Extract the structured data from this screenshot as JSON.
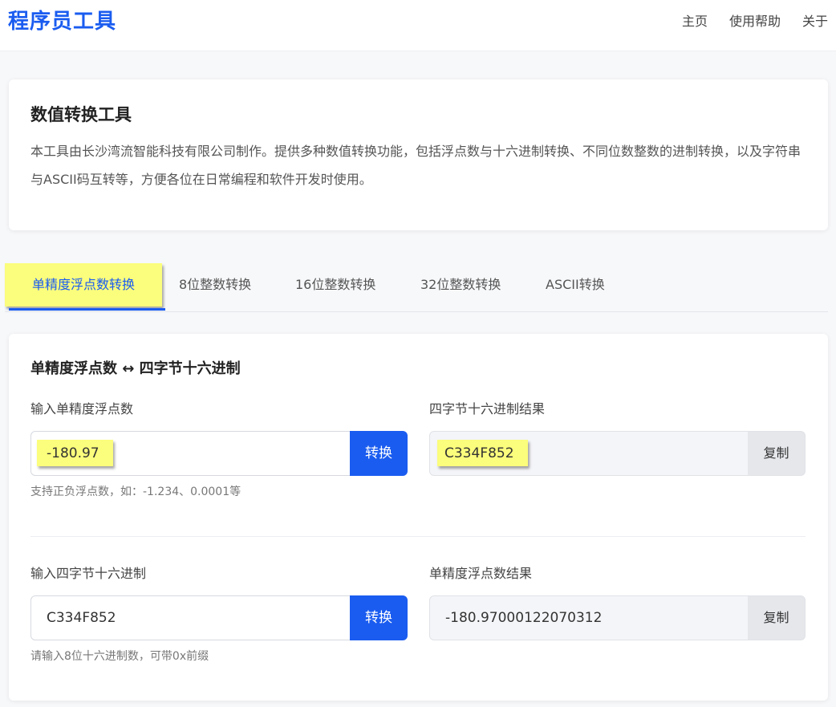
{
  "header": {
    "brand": "程序员工具",
    "nav": [
      "主页",
      "使用帮助",
      "关于"
    ]
  },
  "intro": {
    "title": "数值转换工具",
    "description": "本工具由长沙湾流智能科技有限公司制作。提供多种数值转换功能，包括浮点数与十六进制转换、不同位数整数的进制转换，以及字符串与ASCII码互转等，方便各位在日常编程和软件开发时使用。"
  },
  "tabs": [
    {
      "label": "单精度浮点数转换",
      "active": true
    },
    {
      "label": "8位整数转换",
      "active": false
    },
    {
      "label": "16位整数转换",
      "active": false
    },
    {
      "label": "32位整数转换",
      "active": false
    },
    {
      "label": "ASCII转换",
      "active": false
    }
  ],
  "panel": {
    "title": "单精度浮点数 ↔ 四字节十六进制",
    "float_to_hex": {
      "input_label": "输入单精度浮点数",
      "input_value": "-180.97",
      "convert_label": "转换",
      "hint": "支持正负浮点数，如：-1.234、0.0001等",
      "result_label": "四字节十六进制结果",
      "result_value": "C334F852",
      "copy_label": "复制"
    },
    "hex_to_float": {
      "input_label": "输入四字节十六进制",
      "input_value": "C334F852",
      "convert_label": "转换",
      "hint": "请输入8位十六进制数，可带0x前缀",
      "result_label": "单精度浮点数结果",
      "result_value": "-180.97000122070312",
      "copy_label": "复制"
    }
  },
  "colors": {
    "accent": "#1a5cf0",
    "highlight": "#fbfd7c",
    "background": "#f7f8fa"
  }
}
